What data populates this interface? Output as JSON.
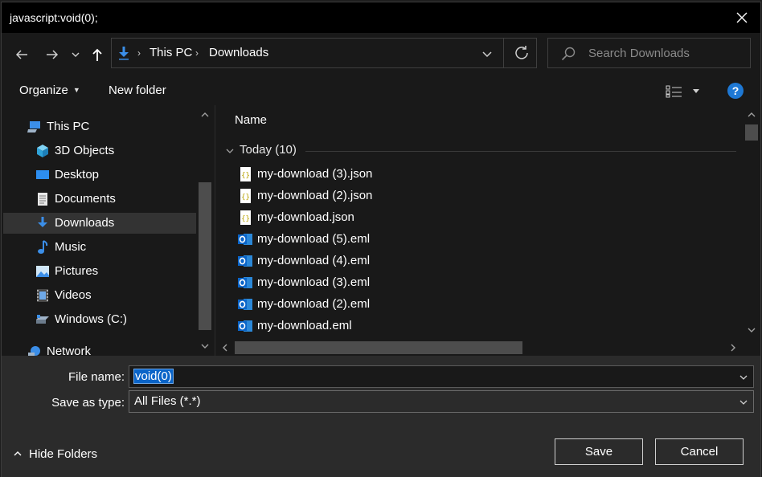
{
  "window": {
    "title": "javascript:void(0);"
  },
  "address": {
    "crumbs": [
      "This PC",
      "Downloads"
    ]
  },
  "search": {
    "placeholder": "Search Downloads"
  },
  "toolbar": {
    "organize_label": "Organize",
    "new_folder_label": "New folder",
    "help_label": "?"
  },
  "sidebar": {
    "items": [
      {
        "label": "This PC",
        "icon": "computer-icon"
      },
      {
        "label": "3D Objects",
        "icon": "cube-icon"
      },
      {
        "label": "Desktop",
        "icon": "desktop-icon"
      },
      {
        "label": "Documents",
        "icon": "document-icon"
      },
      {
        "label": "Downloads",
        "icon": "download-icon",
        "selected": true
      },
      {
        "label": "Music",
        "icon": "music-icon"
      },
      {
        "label": "Pictures",
        "icon": "picture-icon"
      },
      {
        "label": "Videos",
        "icon": "video-icon"
      },
      {
        "label": "Windows (C:)",
        "icon": "drive-icon"
      },
      {
        "label": "Network",
        "icon": "network-icon"
      }
    ]
  },
  "files": {
    "column_name": "Name",
    "group_label": "Today (10)",
    "items": [
      {
        "name": "my-download (3).json",
        "icon": "json-file-icon"
      },
      {
        "name": "my-download (2).json",
        "icon": "json-file-icon"
      },
      {
        "name": "my-download.json",
        "icon": "json-file-icon"
      },
      {
        "name": "my-download (5).eml",
        "icon": "outlook-file-icon"
      },
      {
        "name": "my-download (4).eml",
        "icon": "outlook-file-icon"
      },
      {
        "name": "my-download (3).eml",
        "icon": "outlook-file-icon"
      },
      {
        "name": "my-download (2).eml",
        "icon": "outlook-file-icon"
      },
      {
        "name": "my-download.eml",
        "icon": "outlook-file-icon"
      }
    ]
  },
  "form": {
    "file_name_label": "File name:",
    "file_name_value": "void(0)",
    "save_as_type_label": "Save as type:",
    "save_as_type_value": "All Files (*.*)"
  },
  "footer": {
    "hide_folders_label": "Hide Folders",
    "save_label": "Save",
    "cancel_label": "Cancel"
  },
  "colors": {
    "accent": "#1e78d4",
    "selection": "#0a64c8",
    "background": "#191919"
  }
}
